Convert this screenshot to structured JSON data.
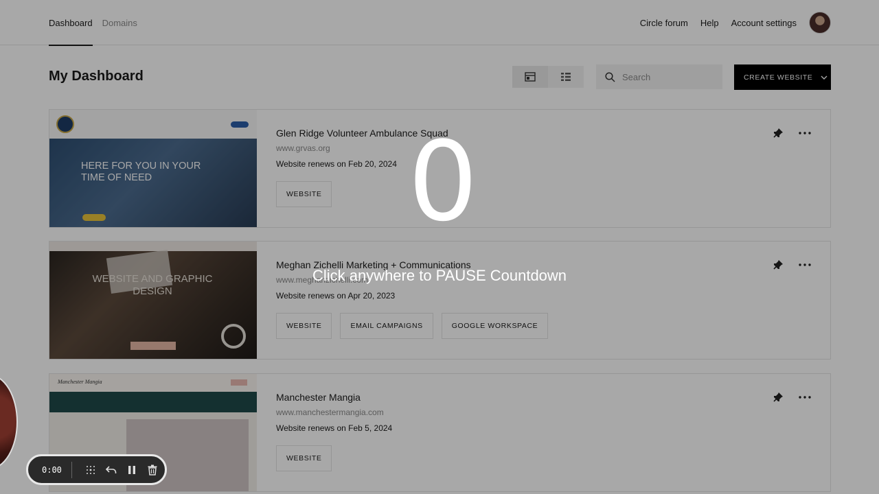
{
  "topnav": {
    "left_links": [
      "Dashboard",
      "Domains"
    ],
    "right_links": [
      "Circle forum",
      "Help",
      "Account settings"
    ]
  },
  "header": {
    "title": "My Dashboard",
    "search_placeholder": "Search",
    "create_label": "CREATE WEBSITE"
  },
  "sites": [
    {
      "name": "Glen Ridge Volunteer Ambulance Squad",
      "url": "www.grvas.org",
      "renewal": "Website renews on Feb 20, 2024",
      "actions": [
        "WEBSITE"
      ],
      "thumb_headline": "HERE FOR YOU IN YOUR TIME OF NEED"
    },
    {
      "name": "Meghan Zichelli Marketing + Communications",
      "url": "www.meghanzichelli.com",
      "renewal": "Website renews on Apr 20, 2023",
      "actions": [
        "WEBSITE",
        "EMAIL CAMPAIGNS",
        "GOOGLE WORKSPACE"
      ],
      "thumb_headline": "WEBSITE AND GRAPHIC DESIGN"
    },
    {
      "name": "Manchester Mangia",
      "url": "www.manchestermangia.com",
      "renewal": "Website renews on Feb 5, 2024",
      "actions": [
        "WEBSITE"
      ],
      "thumb_headline": "Manchester Mangia"
    }
  ],
  "overlay": {
    "countdown": "0",
    "message": "Click anywhere to PAUSE Countdown"
  },
  "recorder": {
    "time": "0:00"
  },
  "colors": {
    "primary_button": "#000000",
    "overlay": "rgba(0,0,0,0.34)",
    "accent": "#1a1a1a"
  }
}
